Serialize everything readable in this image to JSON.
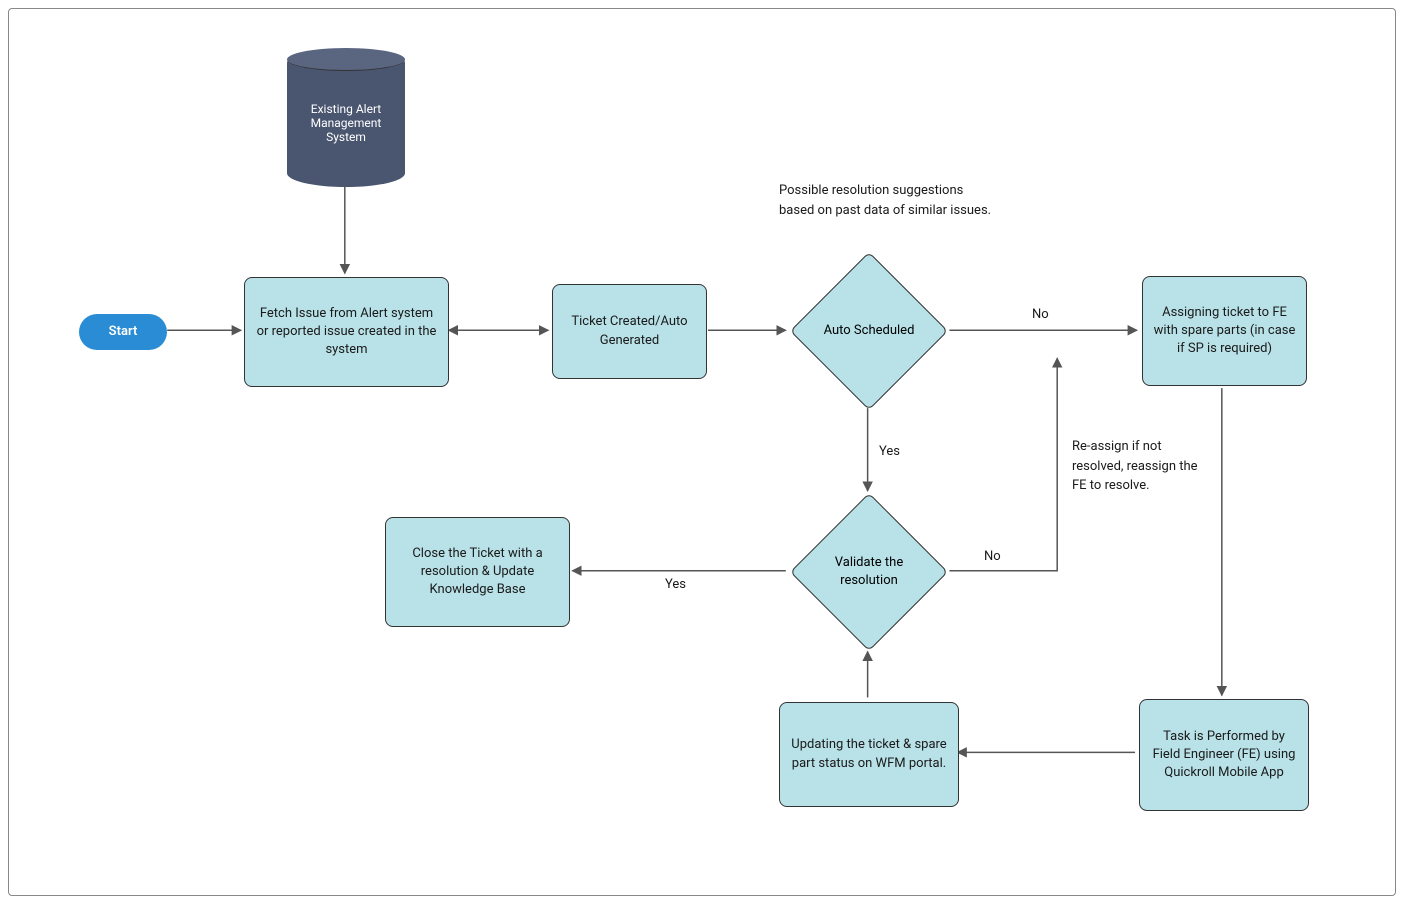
{
  "nodes": {
    "start": {
      "label": "Start"
    },
    "cylinder": {
      "label": "Existing Alert Management System"
    },
    "fetch": {
      "label": "Fetch Issue from Alert system or reported issue created in the system"
    },
    "ticket": {
      "label": "Ticket Created/Auto Generated"
    },
    "autoSched": {
      "label": "Auto Scheduled"
    },
    "assign": {
      "label": "Assigning ticket to FE with spare parts (in case if SP is required)"
    },
    "task": {
      "label": "Task is Performed by Field Engineer (FE) using Quickroll Mobile App"
    },
    "update": {
      "label": "Updating the ticket & spare part status on WFM portal."
    },
    "validate": {
      "label": "Validate the resolution"
    },
    "close": {
      "label": "Close the Ticket with a resolution & Update Knowledge Base"
    }
  },
  "annotations": {
    "top": "Possible resolution suggestions based on past data of similar issues.",
    "right": "Re-assign if not resolved, reassign the FE to resolve."
  },
  "edgeLabels": {
    "autoNo": "No",
    "autoYes": "Yes",
    "validateNo": "No",
    "validateYes": "Yes"
  },
  "colors": {
    "nodeFill": "#b8e2e8",
    "startFill": "#2a8cd4",
    "cylinderFill": "#4a5570",
    "stroke": "#333",
    "arrow": "#555"
  }
}
